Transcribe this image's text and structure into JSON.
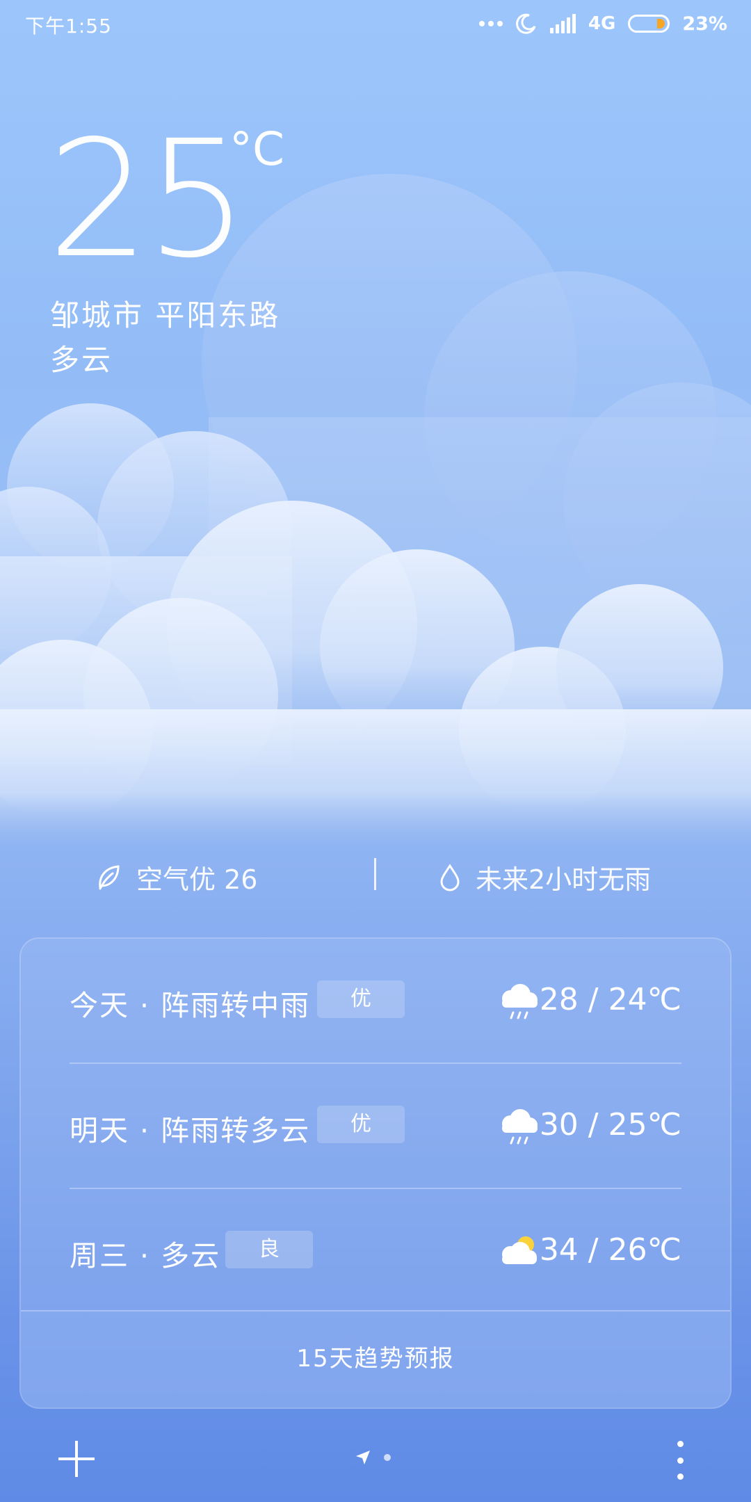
{
  "status_bar": {
    "time": "下午1:55",
    "network": "4G",
    "battery_percent": "23%",
    "battery_level": 0.23,
    "icons": [
      "dots-icon",
      "moon-icon",
      "signal-icon",
      "battery-icon"
    ]
  },
  "current": {
    "temperature": "25",
    "unit": "°C",
    "location": "邹城市 平阳东路",
    "condition": "多云"
  },
  "info": {
    "aqi_text": "空气优 26",
    "rain_text": "未来2小时无雨"
  },
  "forecast": [
    {
      "day": "今天 · 阵雨转中雨",
      "aqi": "优",
      "icon": "rain-cloud-icon",
      "temp": "28 / 24℃"
    },
    {
      "day": "明天 · 阵雨转多云",
      "aqi": "优",
      "icon": "rain-cloud-icon",
      "temp": "30 / 25℃"
    },
    {
      "day": "周三 · 多云",
      "aqi": "良",
      "icon": "partly-cloudy-icon",
      "temp": "34 / 26℃"
    }
  ],
  "trend_label": "15天趋势预报",
  "colors": {
    "sky_top": "#9cc6fb",
    "sky_bottom": "#5f8be6",
    "battery_accent": "#f6a623",
    "sun": "#f9d23c"
  }
}
